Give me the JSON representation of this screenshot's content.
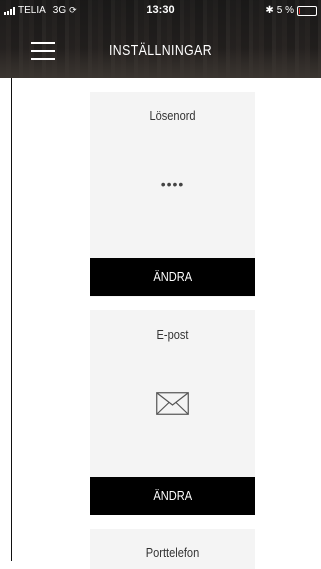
{
  "status_bar": {
    "carrier": "TELIA",
    "network": "3G",
    "time": "13:30",
    "battery_text": "5 %",
    "battery_level_percent": 5
  },
  "header": {
    "title": "INSTÄLLNINGAR"
  },
  "cards": [
    {
      "title": "Lösenord",
      "value": "••••",
      "button_label": "ÄNDRA"
    },
    {
      "title": "E-post",
      "icon": "mail-icon",
      "button_label": "ÄNDRA"
    },
    {
      "title": "Porttelefon"
    }
  ],
  "colors": {
    "button_bg": "#000000",
    "card_bg": "#f4f4f4",
    "battery_low": "#e0332c"
  }
}
